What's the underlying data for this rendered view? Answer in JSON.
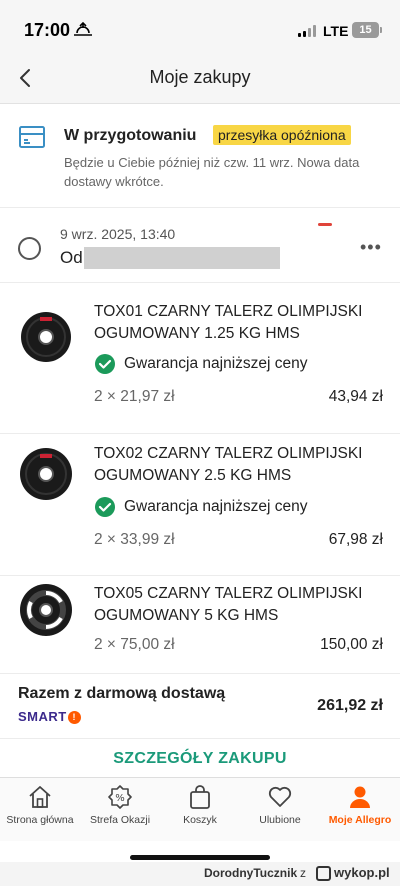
{
  "status_bar": {
    "time": "17:00",
    "network": "LTE",
    "battery": "15"
  },
  "header": {
    "title": "Moje zakupy"
  },
  "status": {
    "title": "W przygotowaniu",
    "badge": "przesyłka opóźniona",
    "description": "Będzie u Ciebie później niż czw. 11 wrz. Nowa data dostawy wkrótce."
  },
  "order": {
    "date": "9 wrz. 2025, 13:40",
    "seller_prefix": "Od"
  },
  "items": [
    {
      "name": "TOX01 CZARNY TALERZ OLIMPIJSKI OGUMOWANY 1.25 KG HMS",
      "badge": "Gwarancja najniższej ceny",
      "qty_price": "2 × 21,97 zł",
      "total": "43,94 zł"
    },
    {
      "name": "TOX02 CZARNY TALERZ OLIMPIJSKI OGUMOWANY 2.5 KG HMS",
      "badge": "Gwarancja najniższej ceny",
      "qty_price": "2 × 33,99 zł",
      "total": "67,98 zł"
    },
    {
      "name": "TOX05 CZARNY TALERZ OLIMPIJSKI OGUMOWANY 5 KG HMS",
      "qty_price": "2 × 75,00 zł",
      "total": "150,00 zł"
    }
  ],
  "summary": {
    "label": "Razem z darmową dostawą",
    "smart_logo": "SMART",
    "smart_mark": "!",
    "value": "261,92 zł"
  },
  "details_link": "SZCZEGÓŁY ZAKUPU",
  "tabs": [
    {
      "label": "Strona główna",
      "icon": "home-icon"
    },
    {
      "label": "Strefa Okazji",
      "icon": "percent-tag-icon"
    },
    {
      "label": "Koszyk",
      "icon": "bag-icon"
    },
    {
      "label": "Ulubione",
      "icon": "heart-icon"
    },
    {
      "label": "Moje Allegro",
      "icon": "user-icon"
    }
  ],
  "credit": {
    "user": "DorodnyTucznik",
    "connector": "z",
    "site": "wykop.pl"
  },
  "colors": {
    "accent": "#ff5a00",
    "link": "#1b9a7a",
    "badge_bg": "#f8d645",
    "status_icon": "#3a8fc4",
    "check_green": "#1b9a5a"
  }
}
